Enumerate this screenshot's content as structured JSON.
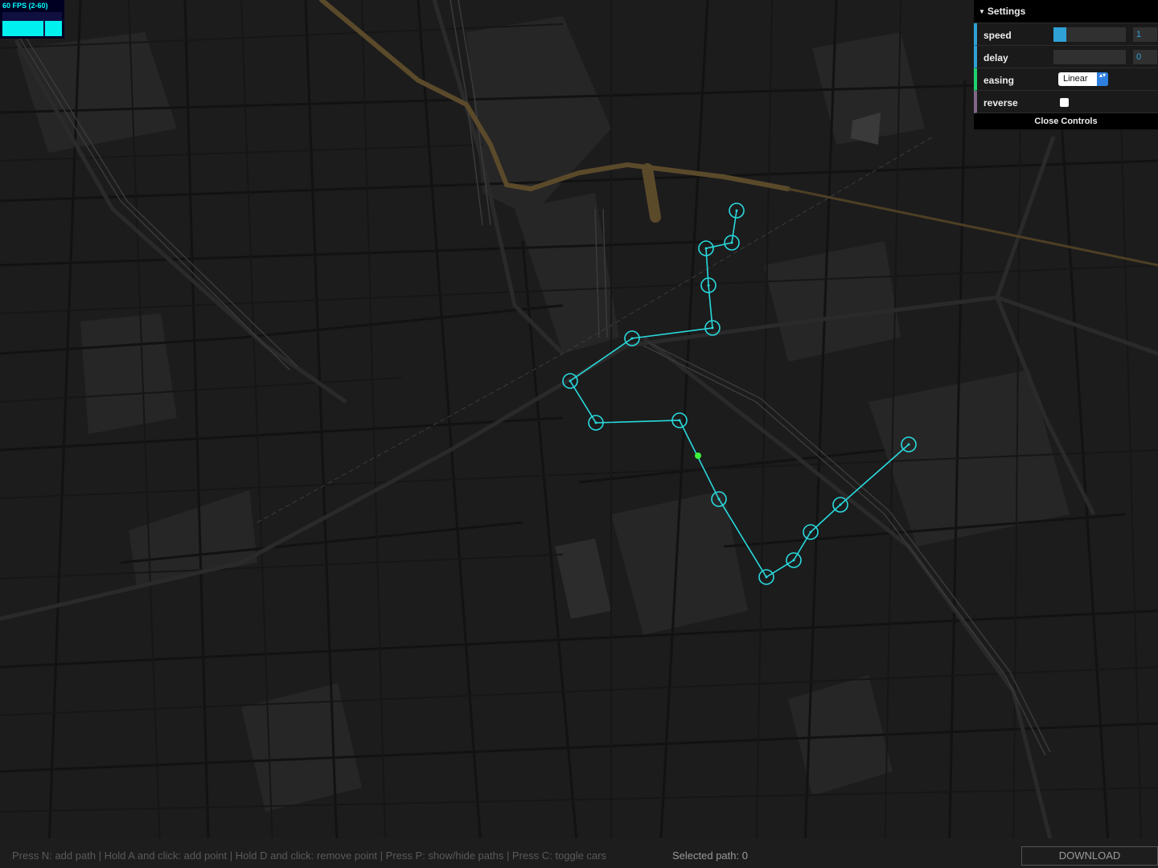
{
  "fps": {
    "label": "60 FPS (2-60)"
  },
  "settings": {
    "title": "Settings",
    "speed": {
      "label": "speed",
      "value": "1",
      "fraction": 0.18
    },
    "delay": {
      "label": "delay",
      "value": "0",
      "fraction": 0
    },
    "easing": {
      "label": "easing",
      "value": "Linear",
      "arrow": "▴▾"
    },
    "reverse": {
      "label": "reverse",
      "checked": false
    },
    "close_label": "Close Controls"
  },
  "footer": {
    "hint": "Press N: add path | Hold A and click: add point | Hold D and click: remove point | Press P: show/hide paths | Press C: toggle cars",
    "selected_path": "Selected path: 0",
    "download_label": "DOWNLOAD"
  },
  "colors": {
    "map_background": "#1c1c1d",
    "path": "#29d9dc",
    "car": "#3df13a",
    "rail": "#5b4a2a"
  }
}
